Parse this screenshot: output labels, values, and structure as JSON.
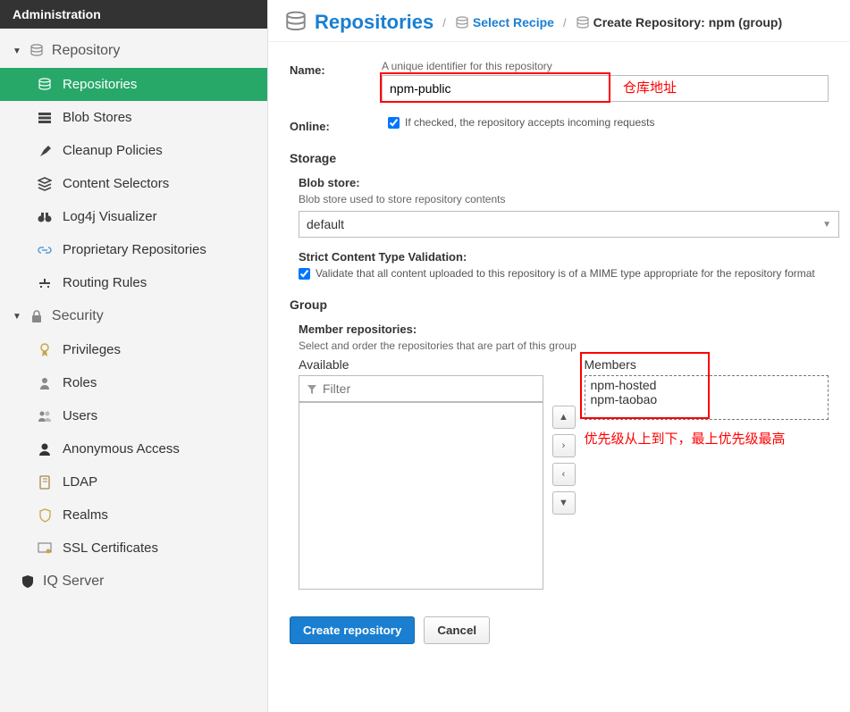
{
  "adminHeader": "Administration",
  "groups": {
    "repository": {
      "label": "Repository"
    },
    "security": {
      "label": "Security"
    },
    "iq": {
      "label": "IQ Server"
    }
  },
  "sidebar": [
    {
      "label": "Repositories",
      "active": true
    },
    {
      "label": "Blob Stores"
    },
    {
      "label": "Cleanup Policies"
    },
    {
      "label": "Content Selectors"
    },
    {
      "label": "Log4j Visualizer"
    },
    {
      "label": "Proprietary Repositories"
    },
    {
      "label": "Routing Rules"
    }
  ],
  "sidebar2": [
    {
      "label": "Privileges"
    },
    {
      "label": "Roles"
    },
    {
      "label": "Users"
    },
    {
      "label": "Anonymous Access"
    },
    {
      "label": "LDAP"
    },
    {
      "label": "Realms"
    },
    {
      "label": "SSL Certificates"
    }
  ],
  "crumb": {
    "title": "Repositories",
    "link": "Select Recipe",
    "current": "Create Repository: npm (group)"
  },
  "form": {
    "nameLabel": "Name:",
    "nameHint": "A unique identifier for this repository",
    "nameValue": "npm-public",
    "onlineLabel": "Online:",
    "onlineHint": "If checked, the repository accepts incoming requests",
    "storageHeading": "Storage",
    "blobLabel": "Blob store:",
    "blobHint": "Blob store used to store repository contents",
    "blobValue": "default",
    "strictLabel": "Strict Content Type Validation:",
    "strictHint": "Validate that all content uploaded to this repository is of a MIME type appropriate for the repository format",
    "groupHeading": "Group",
    "memberLabel": "Member repositories:",
    "memberHint": "Select and order the repositories that are part of this group",
    "availableLabel": "Available",
    "membersLabel": "Members",
    "filterPlaceholder": "Filter",
    "members": [
      "npm-hosted",
      "npm-taobao"
    ],
    "btnCreate": "Create repository",
    "btnCancel": "Cancel"
  },
  "annotations": {
    "addr": "仓库地址",
    "priority": "优先级从上到下，最上优先级最高"
  }
}
